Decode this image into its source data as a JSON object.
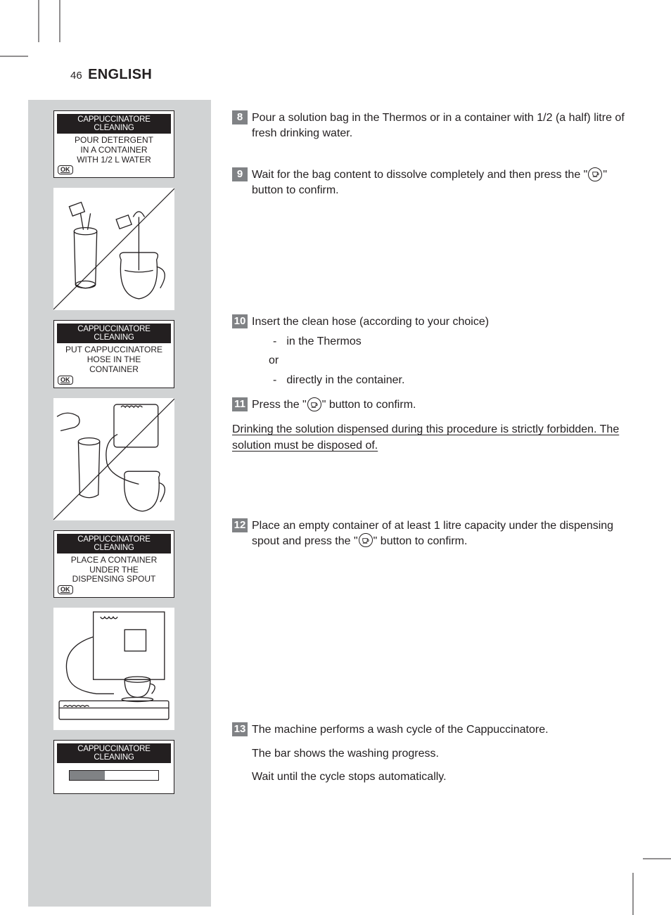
{
  "header": {
    "page_number": "46",
    "language": "ENGLISH"
  },
  "ok_label": "OK",
  "displays": {
    "d1": {
      "title": "CAPPUCCINATORE CLEANING",
      "line1": "POUR DETERGENT",
      "line2": "IN A CONTAINER",
      "line3": "WITH 1/2 L WATER"
    },
    "d2": {
      "title": "CAPPUCCINATORE CLEANING",
      "line1": "PUT CAPPUCCINATORE",
      "line2": "HOSE IN THE",
      "line3": "CONTAINER"
    },
    "d3": {
      "title": "CAPPUCCINATORE CLEANING",
      "line1": "PLACE A CONTAINER",
      "line2": "UNDER THE",
      "line3": "DISPENSING SPOUT"
    },
    "d4": {
      "title": "CAPPUCCINATORE CLEANING"
    }
  },
  "steps": {
    "s8": {
      "num": "8",
      "text": "Pour a solution bag in the Thermos or in a container with 1/2 (a half) litre of fresh drinking water."
    },
    "s9": {
      "num": "9",
      "text_a": "Wait for the bag content to dissolve completely and then press the \"",
      "text_b": "\" button to confirm."
    },
    "s10": {
      "num": "10",
      "text": "Insert the clean hose (according to your choice)",
      "opt1": "in the Thermos",
      "or": "or",
      "opt2": "directly in the container."
    },
    "s11": {
      "num": "11",
      "text_a": "Press the \"",
      "text_b": "\" button to confirm."
    },
    "warning": "Drinking the solution dispensed during this procedure is strictly forbidden. The solution must be disposed of.",
    "s12": {
      "num": "12",
      "text_a": "Place an empty container of at least 1 litre capacity under the dispensing spout and press the \"",
      "text_b": "\" button to confirm."
    },
    "s13": {
      "num": "13",
      "line1": "The machine performs a wash cycle of the Cappuccinatore.",
      "line2": "The bar shows the washing progress.",
      "line3": "Wait until the cycle stops automatically."
    }
  },
  "progress_percent": 40
}
